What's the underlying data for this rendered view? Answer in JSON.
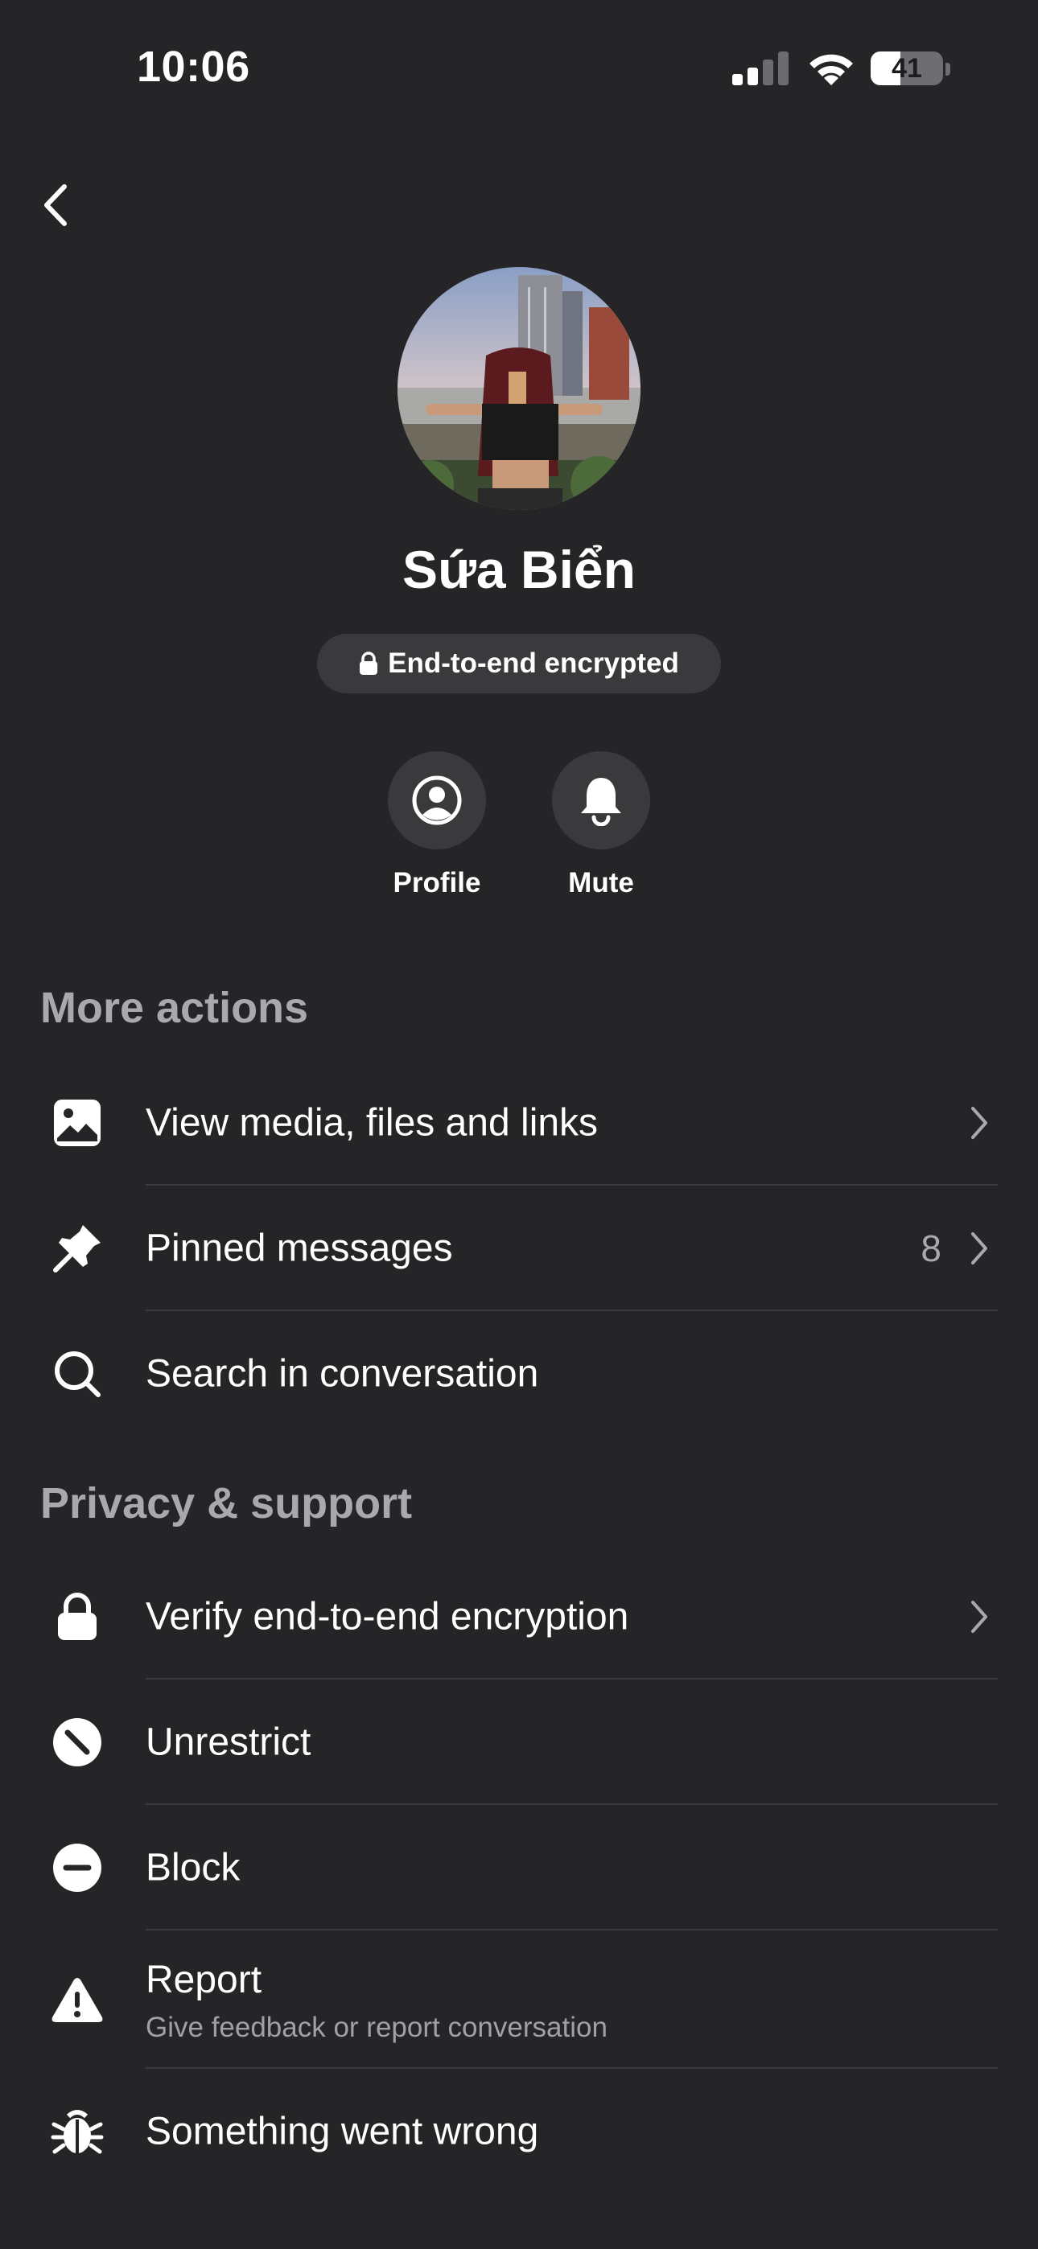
{
  "status_bar": {
    "time": "10:06",
    "battery": "41"
  },
  "contact": {
    "name": "Sứa Biển",
    "encryption_label": "End-to-end encrypted"
  },
  "quick_actions": [
    {
      "label": "Profile",
      "icon": "person-circle-icon"
    },
    {
      "label": "Mute",
      "icon": "bell-icon"
    }
  ],
  "sections": {
    "more_actions": {
      "title": "More actions",
      "items": [
        {
          "label": "View media, files and links",
          "icon": "image-icon"
        },
        {
          "label": "Pinned messages",
          "count": "8",
          "icon": "pin-icon"
        },
        {
          "label": "Search in conversation",
          "icon": "search-icon"
        }
      ]
    },
    "privacy_support": {
      "title": "Privacy & support",
      "items": [
        {
          "label": "Verify end-to-end encryption",
          "icon": "lock-icon"
        },
        {
          "label": "Unrestrict",
          "icon": "restrict-icon"
        },
        {
          "label": "Block",
          "icon": "block-icon"
        },
        {
          "label": "Report",
          "sublabel": "Give feedback or report conversation",
          "icon": "warning-icon"
        },
        {
          "label": "Something went wrong",
          "icon": "bug-icon"
        }
      ]
    }
  },
  "colors": {
    "background": "#252528",
    "pill": "#3a3a3d",
    "secondary_text": "#a8a8ad"
  }
}
